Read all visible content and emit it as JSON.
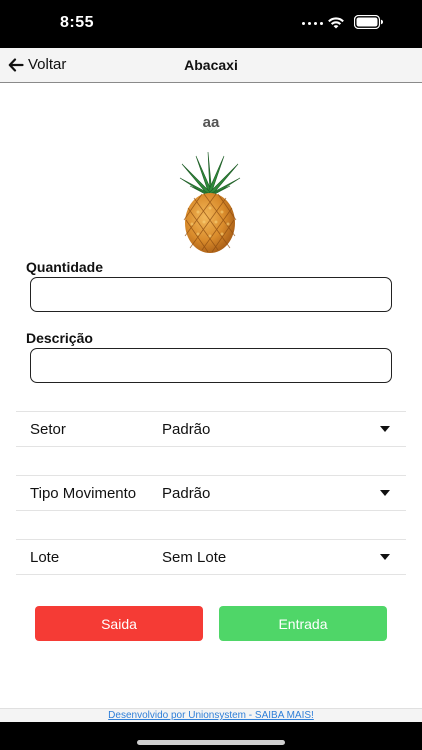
{
  "status_bar": {
    "time": "8:55"
  },
  "header": {
    "back_label": "Voltar",
    "title": "Abacaxi"
  },
  "product": {
    "code": "aa",
    "image_icon": "pineapple-icon"
  },
  "form": {
    "quantity": {
      "label": "Quantidade",
      "value": ""
    },
    "description": {
      "label": "Descrição",
      "value": ""
    }
  },
  "pickers": [
    {
      "label": "Setor",
      "value": "Padrão"
    },
    {
      "label": "Tipo Movimento",
      "value": "Padrão"
    },
    {
      "label": "Lote",
      "value": "Sem Lote"
    }
  ],
  "buttons": {
    "saida": "Saida",
    "entrada": "Entrada"
  },
  "footer": {
    "link_text": "Desenvolvido por Unionsystem - SAIBA MAIS!"
  },
  "colors": {
    "saida_button": "#f53b35",
    "entrada_button": "#4fd668",
    "footer_link": "#2f7fd8"
  }
}
